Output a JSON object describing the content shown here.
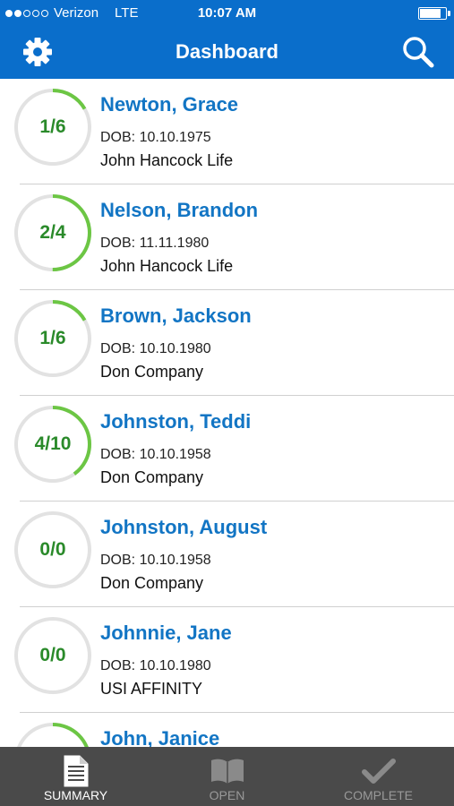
{
  "status_bar": {
    "carrier": "Verizon",
    "network": "LTE",
    "time": "10:07 AM",
    "signal_bars_filled": 2,
    "signal_bars_total": 5,
    "battery_level": 0.85
  },
  "header": {
    "title": "Dashboard",
    "left_icon": "gear-icon",
    "right_icon": "search-icon",
    "background_color": "#0a6ecb"
  },
  "clients": [
    {
      "progress": "1/6",
      "name": "Newton, Grace",
      "dob": "DOB: 10.10.1975",
      "company": "John Hancock Life",
      "fraction": 0.1667
    },
    {
      "progress": "2/4",
      "name": "Nelson, Brandon",
      "dob": "DOB: 11.11.1980",
      "company": "John Hancock Life",
      "fraction": 0.5
    },
    {
      "progress": "1/6",
      "name": "Brown, Jackson",
      "dob": "DOB: 10.10.1980",
      "company": "Don Company",
      "fraction": 0.1667
    },
    {
      "progress": "4/10",
      "name": "Johnston, Teddi",
      "dob": "DOB: 10.10.1958",
      "company": "Don Company",
      "fraction": 0.4
    },
    {
      "progress": "0/0",
      "name": "Johnston, August",
      "dob": "DOB: 10.10.1958",
      "company": "Don Company",
      "fraction": 0
    },
    {
      "progress": "0/0",
      "name": "Johnnie, Jane",
      "dob": "DOB: 10.10.1980",
      "company": "USI AFFINITY",
      "fraction": 0
    },
    {
      "progress": "",
      "name": "John, Janice",
      "dob": "",
      "company": "",
      "fraction": 0.3
    }
  ],
  "tab_bar": {
    "tabs": [
      {
        "label": "SUMMARY",
        "icon": "document-icon",
        "active": true
      },
      {
        "label": "OPEN",
        "icon": "open-book-icon",
        "active": false
      },
      {
        "label": "COMPLETE",
        "icon": "checkmark-icon",
        "active": false
      }
    ]
  },
  "colors": {
    "accent": "#0a6ecb",
    "name_text": "#1275c4",
    "progress_arc": "#6cc644",
    "progress_count": "#2a8a2a",
    "tab_bar": "#4a4a4a"
  }
}
